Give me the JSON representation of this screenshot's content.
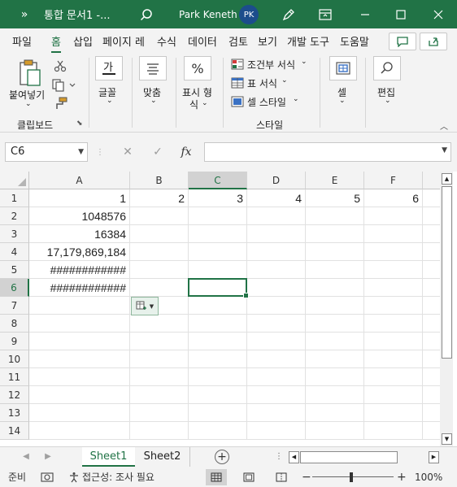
{
  "titlebar": {
    "more": "»",
    "title": "통합 문서1  -...",
    "user": "Park Keneth",
    "avatar": "PK"
  },
  "tabs": [
    {
      "label": "파일"
    },
    {
      "label": "홈"
    },
    {
      "label": "삽입"
    },
    {
      "label": "페이지 레"
    },
    {
      "label": "수식"
    },
    {
      "label": "데이터"
    },
    {
      "label": "검토"
    },
    {
      "label": "보기"
    },
    {
      "label": "개발 도구"
    },
    {
      "label": "도움말"
    }
  ],
  "active_tab": "홈",
  "ribbon": {
    "paste": "붙여넣기",
    "clipboard": "클립보드",
    "font": "글꼴",
    "alignment": "맞춤",
    "number_line1": "표시 형",
    "number_line2": "식",
    "conditional": "조건부 서식",
    "table_format": "표 서식",
    "cell_style": "셀 스타일",
    "styles": "스타일",
    "cells": "셀",
    "editing": "편집"
  },
  "formulabar": {
    "namebox": "C6",
    "fx": "fx",
    "formula": ""
  },
  "columns": [
    "A",
    "B",
    "C",
    "D",
    "E",
    "F"
  ],
  "selected_column": "C",
  "rows": [
    "1",
    "2",
    "3",
    "4",
    "5",
    "6",
    "7",
    "8",
    "9",
    "10",
    "11",
    "12",
    "13",
    "14"
  ],
  "selected_row": "6",
  "cells": {
    "A1": "1",
    "B1": "2",
    "C1": "3",
    "D1": "4",
    "E1": "5",
    "F1": "6",
    "A2": "1048576",
    "A3": "16384",
    "A4": "17,179,869,184",
    "A5": "############",
    "A6": "############"
  },
  "sheets": [
    {
      "label": "Sheet1"
    },
    {
      "label": "Sheet2"
    }
  ],
  "active_sheet": "Sheet1",
  "add_sheet": "+",
  "status": {
    "ready": "준비",
    "accessibility": "접근성: 조사 필요",
    "zoom_minus": "−",
    "zoom_plus": "+",
    "zoom": "100%"
  },
  "colors": {
    "accent": "#217346",
    "title_bg": "#217346",
    "avatar_bg": "#1c4d8c"
  }
}
